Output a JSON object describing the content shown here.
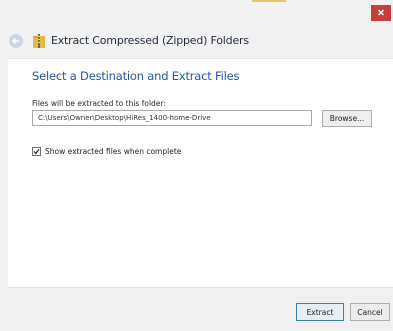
{
  "window": {
    "close_glyph": "×"
  },
  "header": {
    "title": "Extract Compressed (Zipped) Folders",
    "back_icon": "back-arrow-icon",
    "folder_icon": "zip-folder-icon"
  },
  "content": {
    "heading": "Select a Destination and Extract Files",
    "dest_label": "Files will be extracted to this folder:",
    "dest_path_value": "C:\\Users\\Owner\\Desktop\\HiRes_1400-home-Drive",
    "browse_label": "Browse...",
    "show_files_checked": true,
    "show_files_label": "Show extracted files when complete"
  },
  "footer": {
    "extract_label": "Extract",
    "cancel_label": "Cancel"
  },
  "colors": {
    "accent": "#1f57a5",
    "close_red": "#c73f3a",
    "title_strip": "#e3c56a"
  }
}
